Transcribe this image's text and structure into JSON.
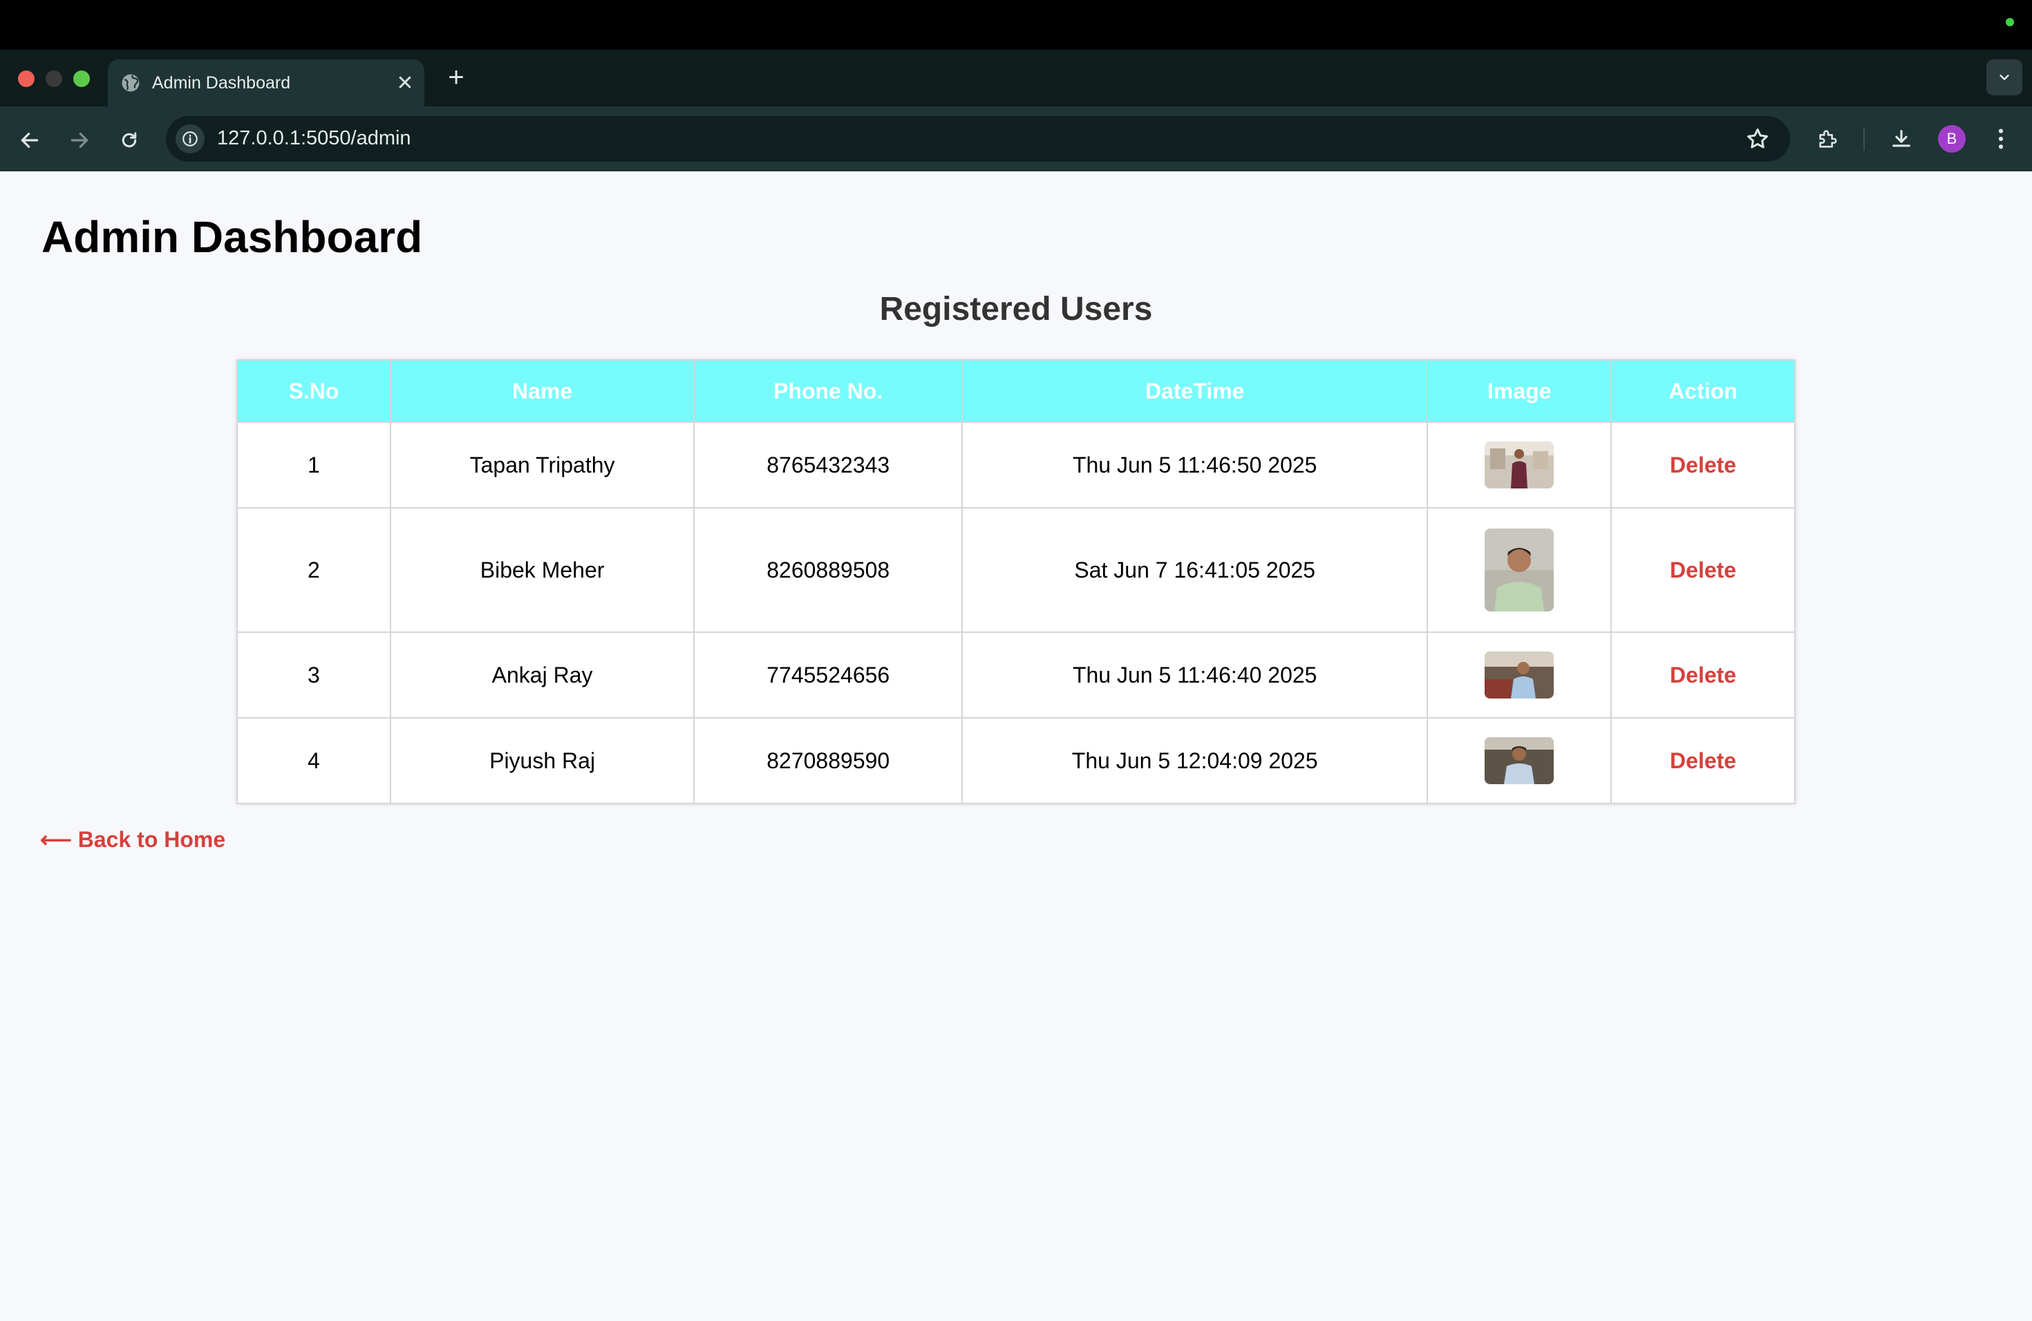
{
  "browser": {
    "tab_title": "Admin Dashboard",
    "url": "127.0.0.1:5050/admin",
    "profile_initial": "B",
    "new_tab_glyph": "+",
    "close_tab_glyph": "✕"
  },
  "page": {
    "title": "Admin Dashboard",
    "section_title": "Registered Users",
    "back_link": "⟵ Back to Home"
  },
  "table": {
    "headers": [
      "S.No",
      "Name",
      "Phone No.",
      "DateTime",
      "Image",
      "Action"
    ],
    "rows": [
      {
        "sno": "1",
        "name": "Tapan Tripathy",
        "phone": "8765432343",
        "datetime": "Thu Jun 5 11:46:50 2025",
        "action": "Delete"
      },
      {
        "sno": "2",
        "name": "Bibek Meher",
        "phone": "8260889508",
        "datetime": "Sat Jun 7 16:41:05 2025",
        "action": "Delete"
      },
      {
        "sno": "3",
        "name": "Ankaj Ray",
        "phone": "7745524656",
        "datetime": "Thu Jun 5 11:46:40 2025",
        "action": "Delete"
      },
      {
        "sno": "4",
        "name": "Piyush Raj",
        "phone": "8270889590",
        "datetime": "Thu Jun 5 12:04:09 2025",
        "action": "Delete"
      }
    ]
  },
  "colors": {
    "header_bg": "#76fcfc",
    "accent_red": "#d6413c",
    "page_bg": "#f7f8fb"
  },
  "icons": [
    "globe-icon",
    "close-icon",
    "plus-icon",
    "chevron-down-icon",
    "back-arrow-icon",
    "forward-arrow-icon",
    "reload-icon",
    "info-icon",
    "star-icon",
    "extensions-icon",
    "download-icon",
    "kebab-menu-icon"
  ]
}
